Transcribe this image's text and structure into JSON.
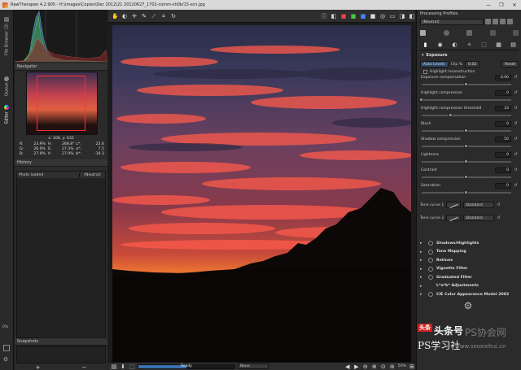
{
  "window": {
    "title": "RawTherapee 4.2.905 - H:\\images\\Copies\\Dec 2012\\21 20120627_1702-comm-sh0b/15-scn.jpg",
    "minimize": "—",
    "maximize": "❐",
    "close": "✕"
  },
  "vtabs": {
    "file_browser": "File Browser (3)",
    "queue": "Queue",
    "editor": "Editor",
    "zoom": "0%"
  },
  "navigator": {
    "title": "Navigator",
    "coords": "x: 106, y: 632",
    "rows": [
      [
        "R:",
        "23.9%",
        "H:",
        "268.8°",
        "L*:",
        "22.6"
      ],
      [
        "G:",
        "26.0%",
        "S:",
        "27.3%",
        "a*:",
        "7.5"
      ],
      [
        "B:",
        "27.9%",
        "V:",
        "27.9%",
        "b*:",
        "-10.3"
      ]
    ]
  },
  "history": {
    "title": "History",
    "col1": "Photo loaded",
    "col2": "(Neutral)"
  },
  "snapshots": {
    "title": "Snapshots",
    "add": "+",
    "remove": "−"
  },
  "statusbar": {
    "ready": "Ready",
    "progress": 0.5,
    "none_select": "None",
    "zoom": "50%"
  },
  "right": {
    "title": "Processing Profiles",
    "profile": "(Neutral)"
  },
  "exposure": {
    "title": "Exposure",
    "auto_levels": "Auto Levels",
    "clip_label": "Clip %",
    "clip_value": "0.02",
    "reset": "Reset",
    "highlight_reconstruction": "Highlight reconstruction",
    "sliders": [
      {
        "label": "Exposure compensation",
        "value": "0.00",
        "pos": 0.5
      },
      {
        "label": "Highlight compression",
        "value": "0",
        "pos": 0.0
      },
      {
        "label": "Highlight compression threshold",
        "value": "33",
        "pos": 0.33
      },
      {
        "label": "Black",
        "value": "0",
        "pos": 0.5
      },
      {
        "label": "Shadow compression",
        "value": "50",
        "pos": 0.5
      },
      {
        "label": "Lightness",
        "value": "0",
        "pos": 0.5
      },
      {
        "label": "Contrast",
        "value": "0",
        "pos": 0.5
      },
      {
        "label": "Saturation",
        "value": "0",
        "pos": 0.5
      }
    ],
    "tone_curve_1": "Tone curve 1",
    "tone_curve_2": "Tone curve 2",
    "standard": "Standard"
  },
  "tools": [
    {
      "label": "Shadows/Highlights"
    },
    {
      "label": "Tone Mapping"
    },
    {
      "label": "Retinex"
    },
    {
      "label": "Vignette Filter"
    },
    {
      "label": "Graduated Filter"
    },
    {
      "label": "L*a*b* Adjustments"
    },
    {
      "label": "CIE Color Appearance Model 2002"
    }
  ],
  "watermark": {
    "badge": "头条",
    "line1": "头条号",
    "line2": "PS协会网",
    "line3": "PS学习社",
    "line4": "www.seoxiehui.cn"
  }
}
